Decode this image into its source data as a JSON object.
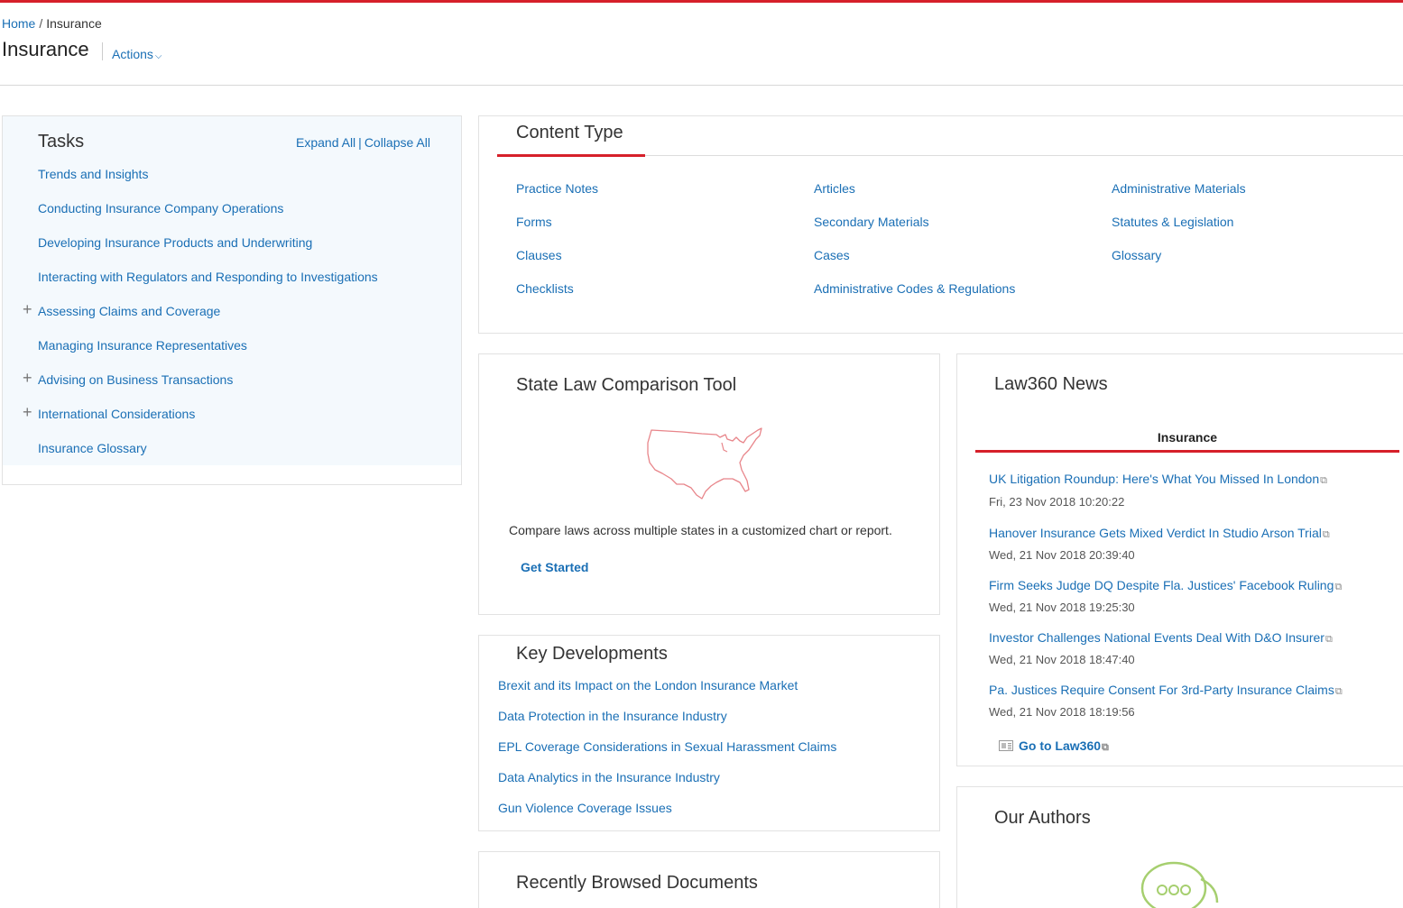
{
  "breadcrumb": {
    "home": "Home",
    "separator": "/",
    "current": "Insurance"
  },
  "page": {
    "title": "Insurance",
    "actions_label": "Actions",
    "actions_chevron": "⌵"
  },
  "colors": {
    "accent_red": "#d6202a",
    "link_blue": "#1a6fb5",
    "tasks_bg": "#f4f9fd"
  },
  "tasks": {
    "title": "Tasks",
    "expand_all": "Expand All",
    "collapse_all": "Collapse All",
    "items": [
      {
        "label": "Trends and Insights",
        "expandable": false
      },
      {
        "label": "Conducting Insurance Company Operations",
        "expandable": false
      },
      {
        "label": "Developing Insurance Products and Underwriting",
        "expandable": false
      },
      {
        "label": "Interacting with Regulators and Responding to Investigations",
        "expandable": false
      },
      {
        "label": "Assessing Claims and Coverage",
        "expandable": true
      },
      {
        "label": "Managing Insurance Representatives",
        "expandable": false
      },
      {
        "label": "Advising on Business Transactions",
        "expandable": true
      },
      {
        "label": "International Considerations",
        "expandable": true
      },
      {
        "label": "Insurance Glossary",
        "expandable": false
      }
    ]
  },
  "content_type": {
    "title": "Content Type",
    "col1": [
      "Practice Notes",
      "Forms",
      "Clauses",
      "Checklists"
    ],
    "col2": [
      "Articles",
      "Secondary Materials",
      "Cases",
      "Administrative Codes & Regulations"
    ],
    "col3": [
      "Administrative Materials",
      "Statutes & Legislation",
      "Glossary"
    ]
  },
  "state_law": {
    "title": "State Law Comparison Tool",
    "icon": "us-map-icon",
    "description": "Compare laws across multiple states in a customized chart or report.",
    "cta": "Get Started"
  },
  "key_developments": {
    "title": "Key Developments",
    "items": [
      "Brexit and its Impact on the London Insurance Market",
      "Data Protection in the Insurance Industry",
      "EPL Coverage Considerations in Sexual Harassment Claims",
      "Data Analytics in the Insurance Industry",
      "Gun Violence Coverage Issues"
    ]
  },
  "recent": {
    "title": "Recently Browsed Documents"
  },
  "law360": {
    "title": "Law360 News",
    "tab": "Insurance",
    "news": [
      {
        "title": "UK Litigation Roundup: Here's What You Missed In London",
        "date": "Fri, 23 Nov 2018 10:20:22"
      },
      {
        "title": "Hanover Insurance Gets Mixed Verdict In Studio Arson Trial",
        "date": "Wed, 21 Nov 2018 20:39:40"
      },
      {
        "title": "Firm Seeks Judge DQ Despite Fla. Justices' Facebook Ruling",
        "date": "Wed, 21 Nov 2018 19:25:30"
      },
      {
        "title": "Investor Challenges National Events Deal With D&O Insurer",
        "date": "Wed, 21 Nov 2018 18:47:40"
      },
      {
        "title": "Pa. Justices Require Consent For 3rd-Party Insurance Claims",
        "date": "Wed, 21 Nov 2018 18:19:56"
      }
    ],
    "goto": "Go to Law360"
  },
  "authors": {
    "title": "Our Authors",
    "icon": "chat-bubble-icon"
  }
}
